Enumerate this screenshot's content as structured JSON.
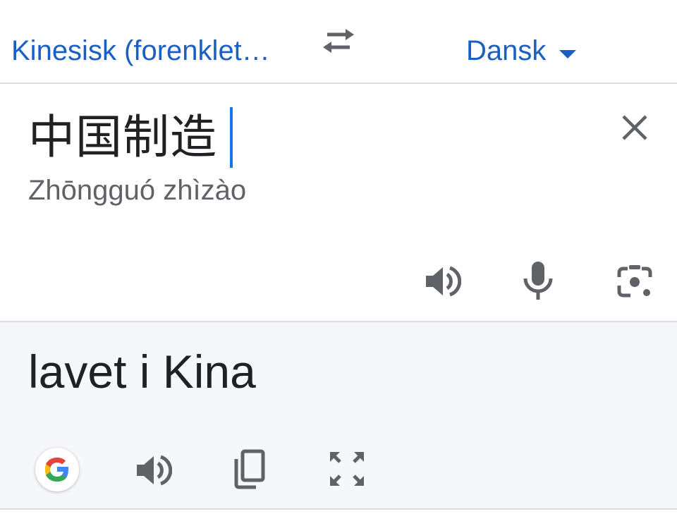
{
  "language_bar": {
    "source_language": "Kinesisk (forenklet…",
    "target_language": "Dansk",
    "swap_icon": "swap-arrows-icon",
    "dropdown_icon": "caret-down-icon"
  },
  "source": {
    "text": "中国制造",
    "romanization": "Zhōngguó zhìzào",
    "clear_icon": "close-icon",
    "actions": [
      "speaker-icon",
      "microphone-icon",
      "camera-icon"
    ]
  },
  "translation": {
    "text": "lavet i Kina",
    "actions": [
      "google-icon",
      "speaker-icon",
      "copy-icon",
      "fullscreen-icon"
    ]
  },
  "colors": {
    "accent_blue": "#1a5fc4",
    "caret_blue": "#1a73e8",
    "icon_gray": "#5f6368",
    "divider": "#dadce0",
    "translation_bg": "#f5f7fa"
  }
}
